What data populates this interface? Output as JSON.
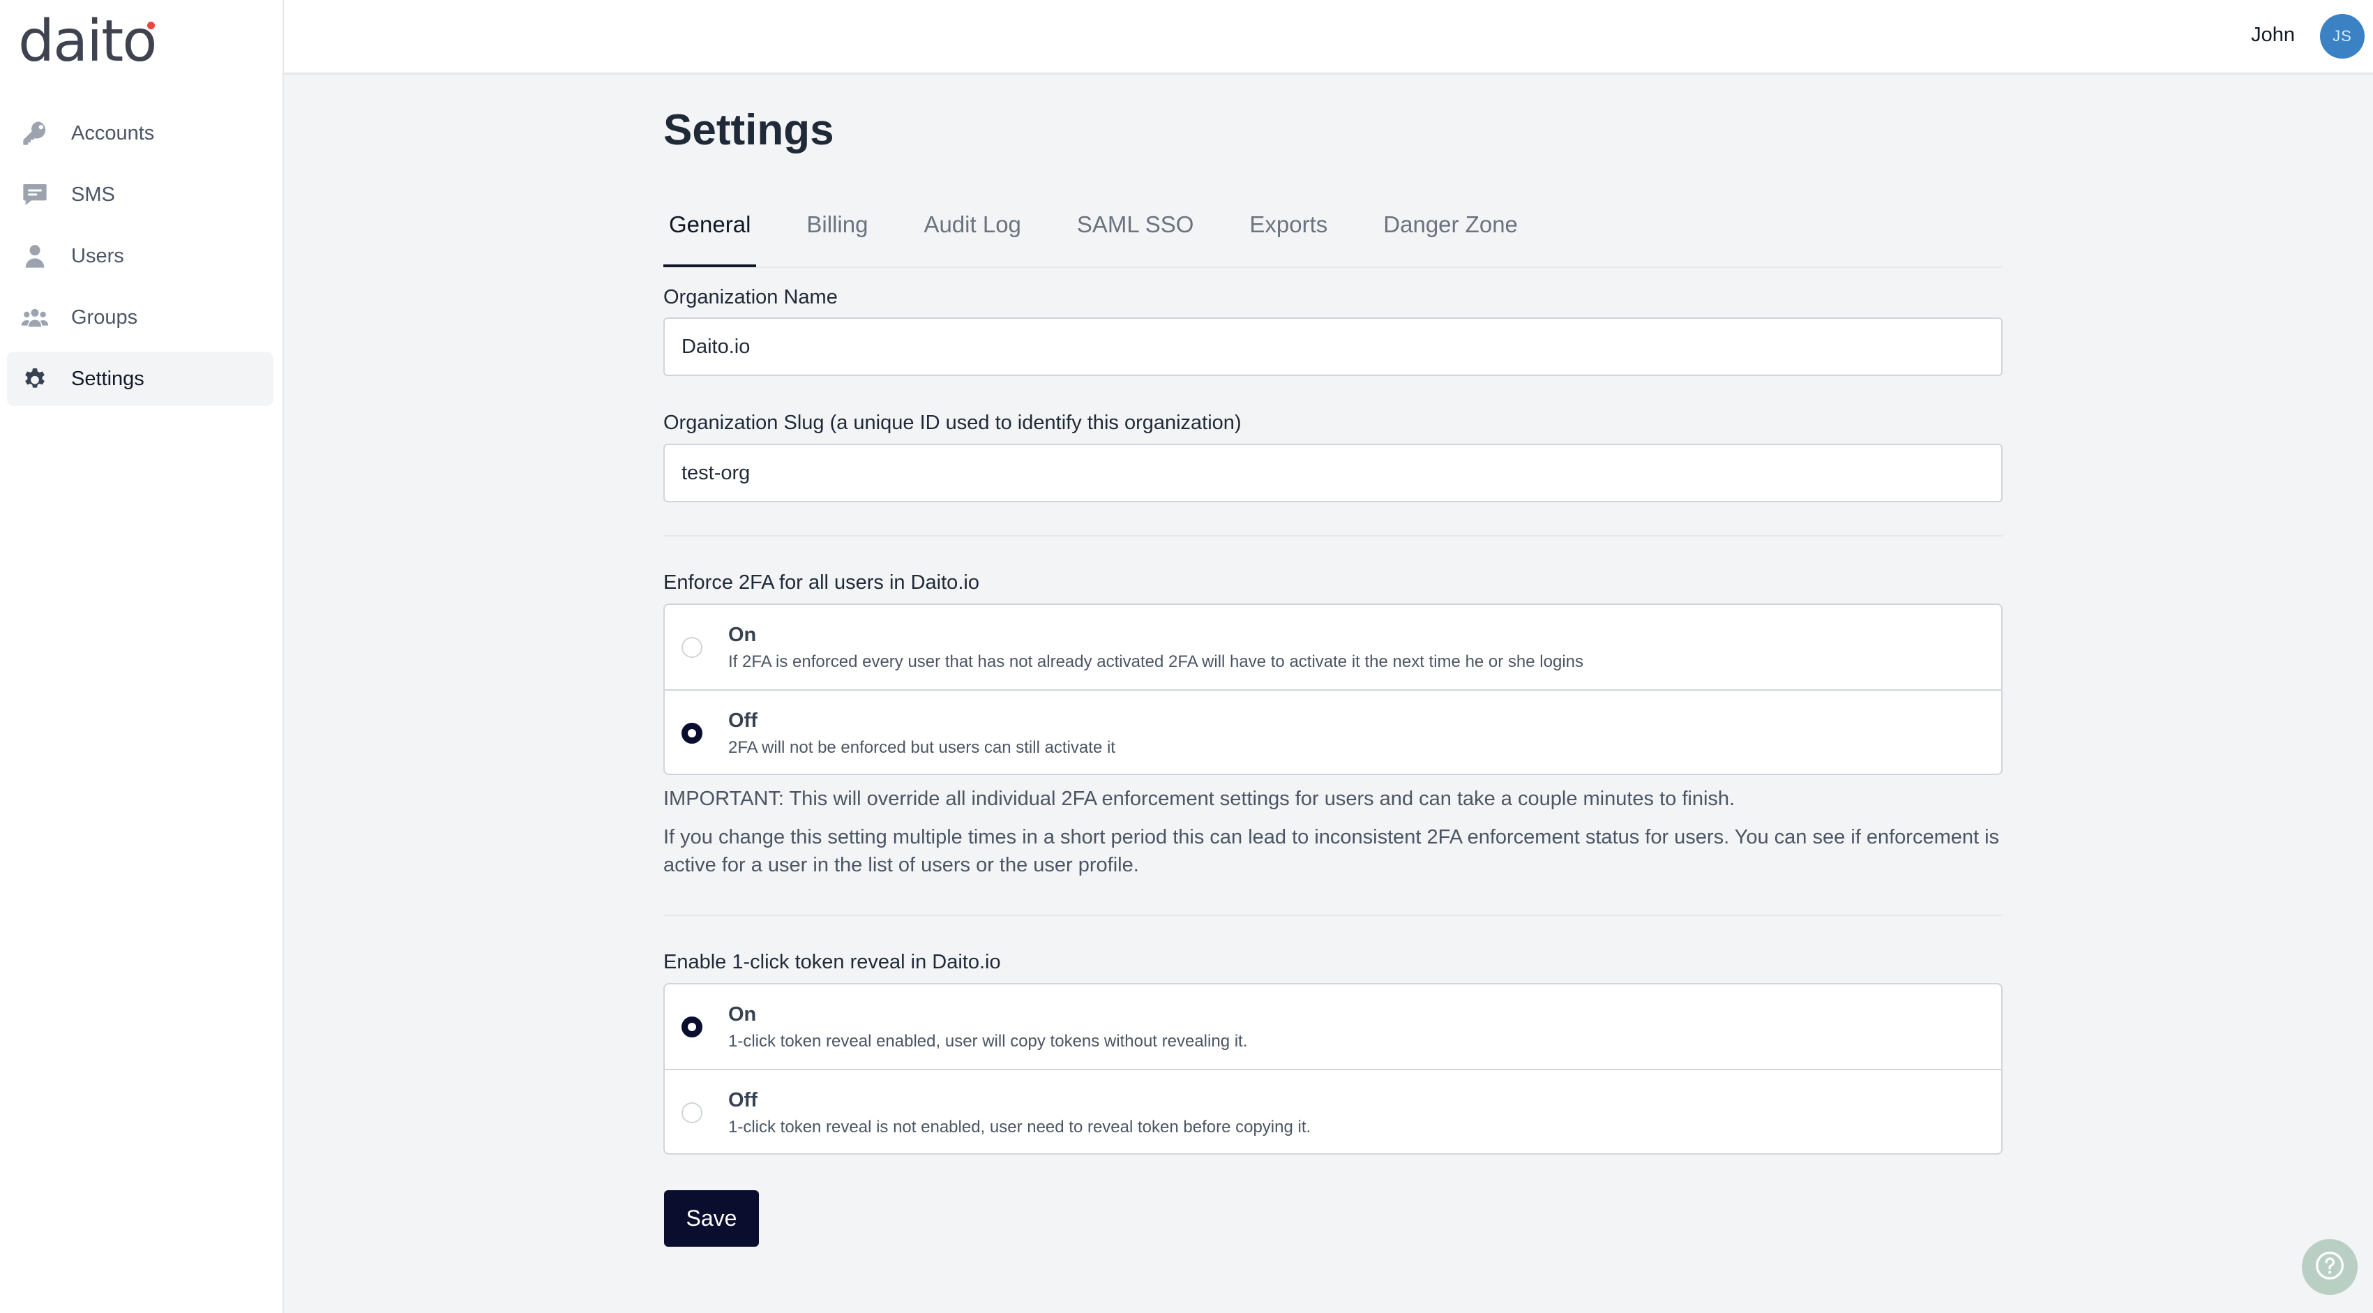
{
  "brand": {
    "logo_text_main": "dait",
    "logo_text_end": "o",
    "accent_dot_color": "#ef4444"
  },
  "sidebar": {
    "items": [
      {
        "label": "Accounts",
        "icon": "key-icon",
        "active": false
      },
      {
        "label": "SMS",
        "icon": "chat-icon",
        "active": false
      },
      {
        "label": "Users",
        "icon": "user-icon",
        "active": false
      },
      {
        "label": "Groups",
        "icon": "users-group-icon",
        "active": false
      },
      {
        "label": "Settings",
        "icon": "gear-icon",
        "active": true
      }
    ]
  },
  "header": {
    "user_name": "John",
    "avatar_initials": "JS",
    "avatar_color": "#3b82c4"
  },
  "page": {
    "title": "Settings"
  },
  "tabs": [
    {
      "label": "General",
      "active": true
    },
    {
      "label": "Billing",
      "active": false
    },
    {
      "label": "Audit Log",
      "active": false
    },
    {
      "label": "SAML SSO",
      "active": false
    },
    {
      "label": "Exports",
      "active": false
    },
    {
      "label": "Danger Zone",
      "active": false
    }
  ],
  "form": {
    "org_name": {
      "label": "Organization Name",
      "value": "Daito.io"
    },
    "org_slug": {
      "label": "Organization Slug (a unique ID used to identify this organization)",
      "value": "test-org"
    },
    "enforce_2fa": {
      "label": "Enforce 2FA for all users in Daito.io",
      "options": [
        {
          "title": "On",
          "description": "If 2FA is enforced every user that has not already activated 2FA will have to activate it the next time he or she logins",
          "checked": false
        },
        {
          "title": "Off",
          "description": "2FA will not be enforced but users can still activate it",
          "checked": true
        }
      ],
      "note_important": "IMPORTANT: This will override all individual 2FA enforcement settings for users and can take a couple minutes to finish.",
      "note_detail": "If you change this setting multiple times in a short period this can lead to inconsistent 2FA enforcement status for users. You can see if enforcement is active for a user in the list of users or the user profile."
    },
    "token_reveal": {
      "label": "Enable 1-click token reveal in Daito.io",
      "options": [
        {
          "title": "On",
          "description": "1-click token reveal enabled, user will copy tokens without revealing it.",
          "checked": true
        },
        {
          "title": "Off",
          "description": "1-click token reveal is not enabled, user need to reveal token before copying it.",
          "checked": false
        }
      ]
    },
    "save_label": "Save"
  },
  "colors": {
    "primary": "#0b0d2e",
    "background": "#f3f4f6",
    "help_button": "#b9cfc4"
  }
}
